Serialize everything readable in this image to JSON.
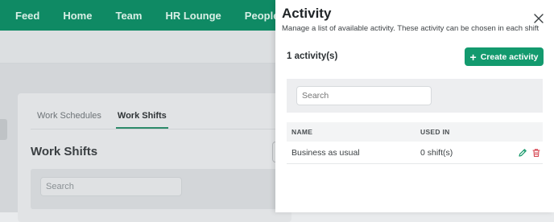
{
  "nav": {
    "items": [
      "Feed",
      "Home",
      "Team",
      "HR Lounge",
      "People"
    ]
  },
  "background": {
    "tabs": [
      "Work Schedules",
      "Work Shifts"
    ],
    "active_tab": "Work Shifts",
    "title": "Work Shifts",
    "search_placeholder": "Search"
  },
  "drawer": {
    "title": "Activity",
    "subtitle": "Manage a list of available activity. These activity can be chosen in each shift",
    "count_label": "1 activity(s)",
    "create_label": "Create activity",
    "search_placeholder": "Search",
    "columns": {
      "name": "NAME",
      "used_in": "USED IN"
    },
    "rows": [
      {
        "name": "Business as usual",
        "used_in": "0 shift(s)"
      }
    ]
  },
  "colors": {
    "brand_green": "#0f8a64",
    "button_green": "#139a6e",
    "delete_red": "#d64550",
    "edit_green": "#1a9a6c"
  },
  "icons": [
    "close-icon",
    "plus-icon",
    "edit-pencil-icon",
    "delete-trash-icon"
  ]
}
